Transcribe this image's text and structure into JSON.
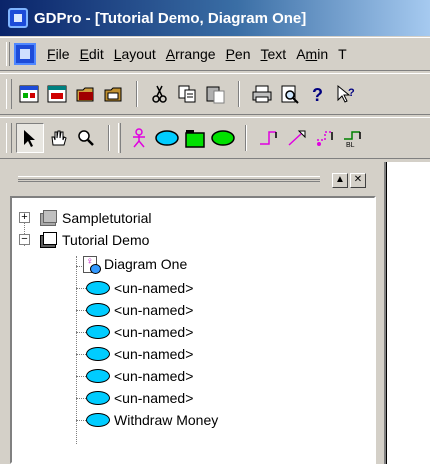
{
  "window": {
    "title": "GDPro - [Tutorial Demo, Diagram One]"
  },
  "menu": {
    "items": [
      {
        "label": "File",
        "mnemonic": "F"
      },
      {
        "label": "Edit",
        "mnemonic": "E"
      },
      {
        "label": "Layout",
        "mnemonic": "L"
      },
      {
        "label": "Arrange",
        "mnemonic": "A"
      },
      {
        "label": "Pen",
        "mnemonic": "P"
      },
      {
        "label": "Text",
        "mnemonic": "T"
      },
      {
        "label": "Admin",
        "mnemonic": "m"
      }
    ],
    "overflow_label": "T"
  },
  "toolbar1": {
    "buttons": [
      "new-diagram-icon",
      "open-diagram-icon",
      "open-icon",
      "save-icon",
      "cut-icon",
      "copy-icon",
      "paste-icon",
      "print-icon",
      "print-preview-icon",
      "help-icon",
      "context-help-icon"
    ]
  },
  "toolbar2": {
    "buttons": [
      "select-arrow-icon",
      "hand-pan-icon",
      "zoom-icon",
      "actor-icon",
      "use-case-icon",
      "package-icon",
      "green-ellipse-icon",
      "association-icon",
      "generalization-icon",
      "dependency-icon",
      "extends-icon"
    ]
  },
  "panel": {
    "minimize_label": "▲",
    "close_label": "✕"
  },
  "tree": {
    "nodes": [
      {
        "label": "Sampletutorial",
        "icon": "folder-icon",
        "expander": "+"
      },
      {
        "label": "Tutorial Demo",
        "icon": "folder-icon",
        "expander": "−"
      },
      {
        "label": "Diagram One",
        "icon": "diagram-icon"
      },
      {
        "label": "<un-named>",
        "icon": "use-case-icon"
      },
      {
        "label": "<un-named>",
        "icon": "use-case-icon"
      },
      {
        "label": "<un-named>",
        "icon": "use-case-icon"
      },
      {
        "label": "<un-named>",
        "icon": "use-case-icon"
      },
      {
        "label": "<un-named>",
        "icon": "use-case-icon"
      },
      {
        "label": "<un-named>",
        "icon": "use-case-icon"
      },
      {
        "label": "Withdraw Money",
        "icon": "use-case-icon"
      }
    ]
  },
  "colors": {
    "titlebar_start": "#0a246a",
    "titlebar_end": "#a6caf0",
    "use_case_fill": "#00ccff",
    "window_face": "#d4d0c8"
  }
}
